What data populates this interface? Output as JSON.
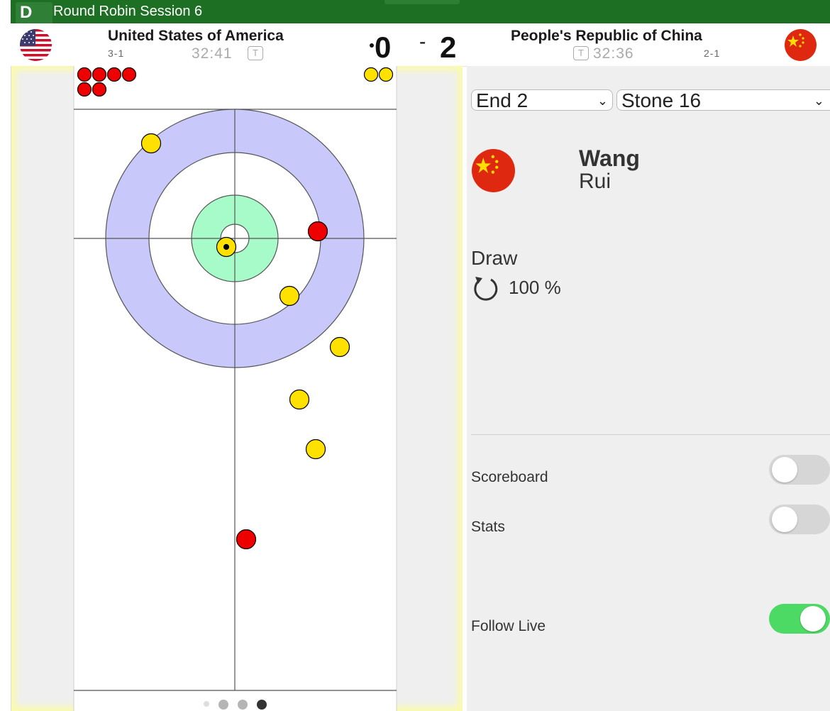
{
  "topbar": {
    "badge": "D",
    "title": "Round Robin Session 6"
  },
  "home": {
    "name": "United States of America",
    "record": "3-1",
    "clock": "32:41",
    "timeout_label": "T",
    "score": "0",
    "flag_icon": "usa-flag-icon",
    "has_hammer": true
  },
  "away": {
    "name": "People's Republic of China",
    "record": "2-1",
    "clock": "32:36",
    "timeout_label": "T",
    "score": "2",
    "flag_icon": "china-flag-icon"
  },
  "score_separator": "-",
  "selectors": {
    "end": "End 2",
    "stone": "Stone 16"
  },
  "player": {
    "first_name": "Wang",
    "last_name": "Rui",
    "flag_icon": "china-flag-icon"
  },
  "shot": {
    "type": "Draw",
    "rotation_icon": "clockwise-rotation-icon",
    "percentage": "100 %"
  },
  "toggles": [
    {
      "label": "Scoreboard",
      "on": false
    },
    {
      "label": "Stats",
      "on": false
    },
    {
      "label": "Follow Live",
      "on": true
    }
  ],
  "sheet": {
    "remaining_stones": {
      "red": 6,
      "yellow": 2
    },
    "stones_in_play": [
      {
        "color": "yellow",
        "note": "top-left of house"
      },
      {
        "color": "red",
        "note": "right of button"
      },
      {
        "color": "yellow",
        "note": "on button, shot stone"
      },
      {
        "color": "yellow",
        "note": "4-foot right low"
      },
      {
        "color": "yellow",
        "note": "right of house below"
      },
      {
        "color": "yellow",
        "note": "guard"
      },
      {
        "color": "yellow",
        "note": "guard"
      },
      {
        "color": "red",
        "note": "centre guard"
      }
    ],
    "pager": {
      "pages": 4,
      "active": 4
    }
  },
  "colors": {
    "red_stone": "#ee0000",
    "yellow_stone": "#ffe100",
    "twelve_foot": "#c8c8fa",
    "four_foot": "#a6fbc8",
    "green_bar": "#1d6f24",
    "toggle_on": "#4cd964"
  }
}
